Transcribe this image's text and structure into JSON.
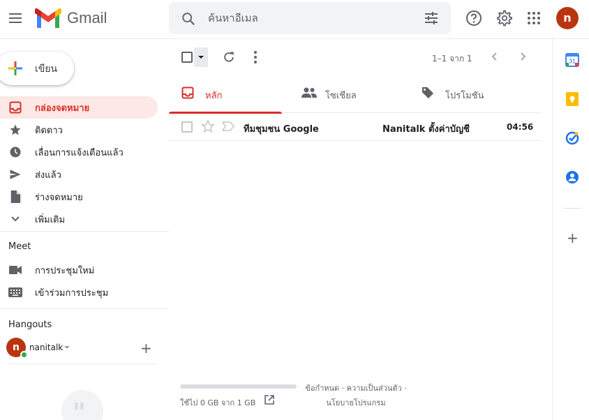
{
  "header": {
    "app_name": "Gmail",
    "search_placeholder": "ค้นหาอีเมล",
    "avatar_letter": "n"
  },
  "compose": {
    "label": "เขียน"
  },
  "nav": {
    "items": [
      {
        "label": "กล่องจดหมาย",
        "icon": "inbox-icon",
        "active": true
      },
      {
        "label": "ติดดาว",
        "icon": "star-icon"
      },
      {
        "label": "เลื่อนการแจ้งเตือนแล้ว",
        "icon": "clock-icon"
      },
      {
        "label": "ส่งแล้ว",
        "icon": "send-icon"
      },
      {
        "label": "ร่างจดหมาย",
        "icon": "draft-icon"
      },
      {
        "label": "เพิ่มเติม",
        "icon": "chevron-down-icon"
      }
    ]
  },
  "meet": {
    "title": "Meet",
    "items": [
      {
        "label": "การประชุมใหม่",
        "icon": "video-icon"
      },
      {
        "label": "เข้าร่วมการประชุม",
        "icon": "keyboard-icon"
      }
    ]
  },
  "hangouts": {
    "title": "Hangouts",
    "avatar_letter": "n",
    "user": "nanitalk"
  },
  "toolbar": {
    "pager": "1–1 จาก 1"
  },
  "tabs": [
    {
      "label": "หลัก",
      "icon": "inbox-icon",
      "active": true
    },
    {
      "label": "โซเชียล",
      "icon": "people-icon"
    },
    {
      "label": "โปรโมชัน",
      "icon": "tag-icon"
    }
  ],
  "mail": [
    {
      "sender": "ทีมชุมชน Google",
      "subject": "Nanitalk ตั้งค่าบัญชี",
      "time": "04:56",
      "unread": true
    }
  ],
  "footer": {
    "storage_used_fraction": 0.0,
    "storage_text": "ใช้ไป 0 GB จาก 1 GB",
    "links_line1": "ข้อกำหนด · ความเป็นส่วนตัว ·",
    "links_line2": "นโยบายโปรแกรม"
  },
  "colors": {
    "accent_red": "#d93025",
    "active_bg": "#fce8e6",
    "avatar": "#b8350f",
    "presence": "#34a853"
  },
  "side_panel": {
    "icons": [
      "calendar-icon",
      "keep-icon",
      "tasks-icon",
      "contacts-icon",
      "add-icon"
    ],
    "calendar_day": "31"
  }
}
